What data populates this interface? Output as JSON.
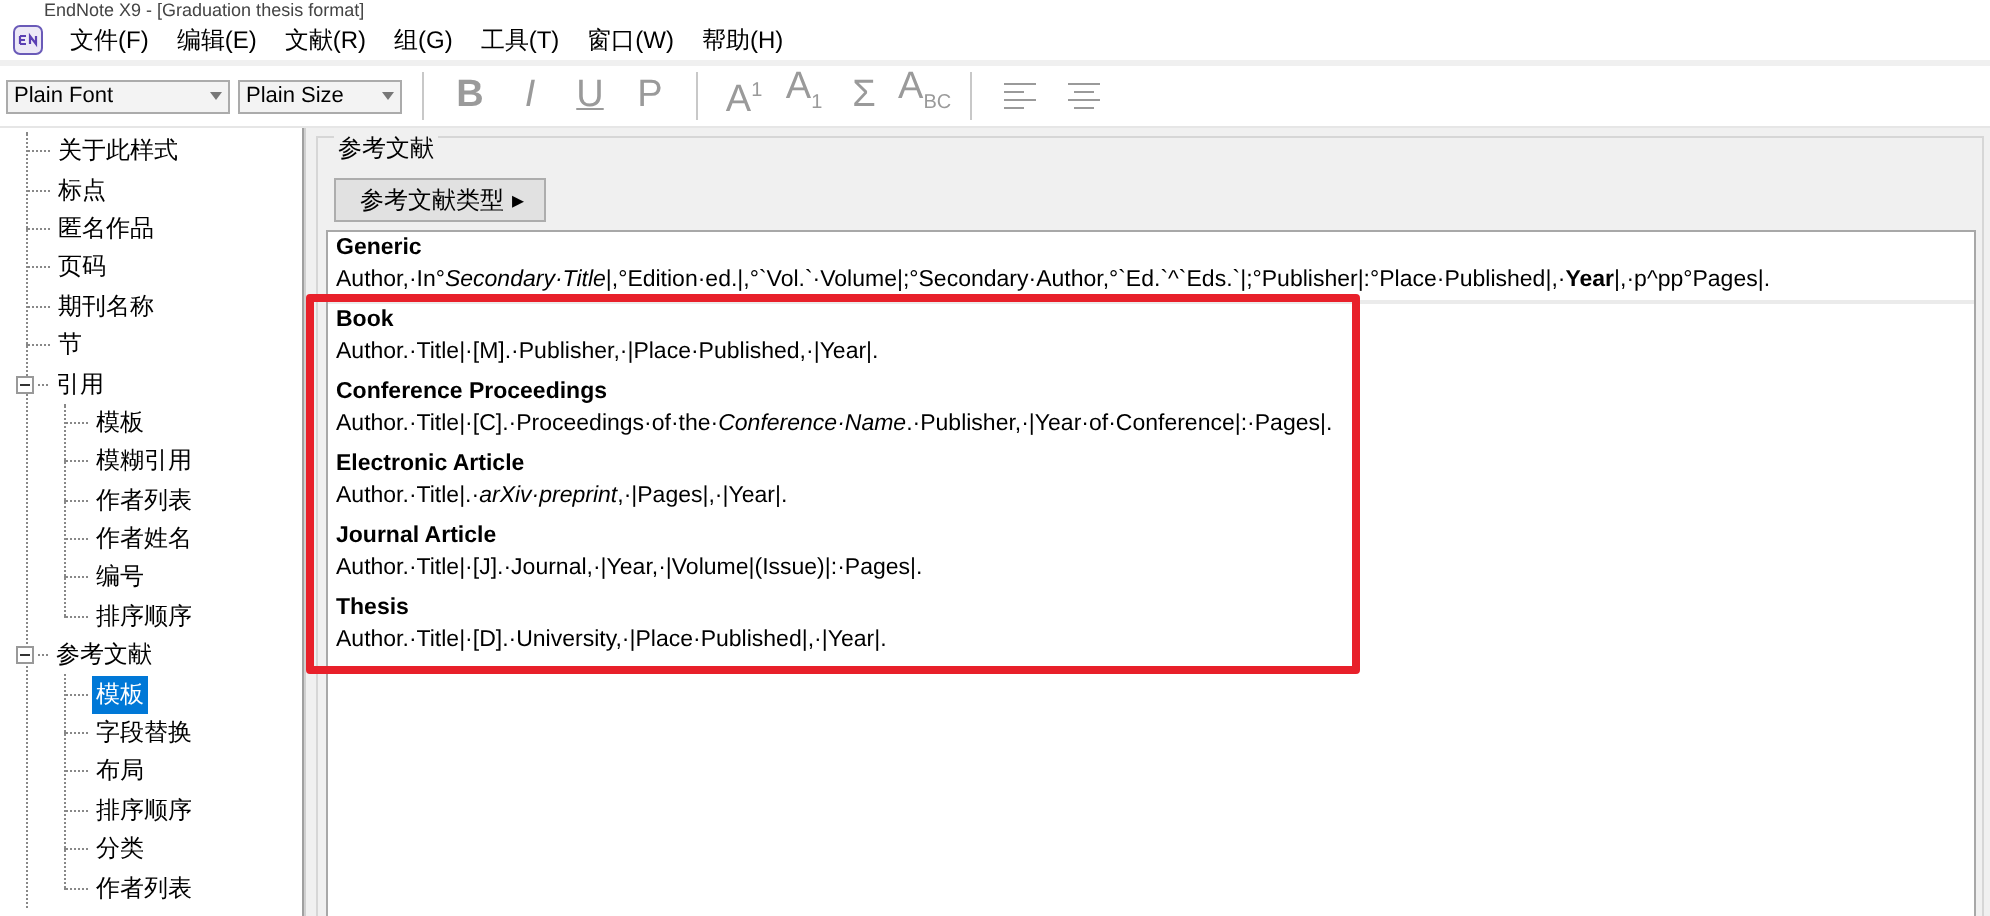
{
  "window": {
    "title": "EndNote X9 - [Graduation thesis format]"
  },
  "menu": [
    {
      "label": "文件(F)"
    },
    {
      "label": "编辑(E)"
    },
    {
      "label": "文献(R)"
    },
    {
      "label": "组(G)"
    },
    {
      "label": "工具(T)"
    },
    {
      "label": "窗口(W)"
    },
    {
      "label": "帮助(H)"
    }
  ],
  "toolbar": {
    "font": "Plain Font",
    "size": "Plain Size",
    "buttons": [
      {
        "kind": "bold",
        "label": "B"
      },
      {
        "kind": "italic",
        "label": "I"
      },
      {
        "kind": "underline",
        "label": "U"
      },
      {
        "kind": "plain",
        "label": "P"
      },
      {
        "kind": "sep"
      },
      {
        "kind": "plain",
        "label": "A$^{1}$"
      },
      {
        "kind": "plain",
        "label": "A$_{1}$"
      },
      {
        "kind": "plain",
        "label": "Σ"
      },
      {
        "kind": "plain",
        "label": "A$_{BC}$"
      },
      {
        "kind": "sep"
      },
      {
        "kind": "align-left"
      },
      {
        "kind": "align-center"
      }
    ]
  },
  "tree": [
    {
      "label": "关于此样式",
      "selected": false
    },
    {
      "label": "标点",
      "selected": false
    },
    {
      "label": "匿名作品",
      "selected": false
    },
    {
      "label": "页码",
      "selected": false
    },
    {
      "label": "期刊名称",
      "selected": false
    },
    {
      "label": "节",
      "selected": false
    },
    {
      "label": "引用",
      "selected": false,
      "expanded": true,
      "children": [
        {
          "label": "模板",
          "selected": false
        },
        {
          "label": "模糊引用",
          "selected": false
        },
        {
          "label": "作者列表",
          "selected": false
        },
        {
          "label": "作者姓名",
          "selected": false
        },
        {
          "label": "编号",
          "selected": false
        },
        {
          "label": "排序顺序",
          "selected": false
        }
      ]
    },
    {
      "label": "参考文献",
      "selected": false,
      "expanded": true,
      "children": [
        {
          "label": "模板",
          "selected": true
        },
        {
          "label": "字段替换",
          "selected": false
        },
        {
          "label": "布局",
          "selected": false
        },
        {
          "label": "排序顺序",
          "selected": false
        },
        {
          "label": "分类",
          "selected": false
        },
        {
          "label": "作者列表",
          "selected": false
        }
      ]
    }
  ],
  "panel": {
    "title": "参考文献",
    "type_button": "参考文献类型",
    "type_button_arrow": "▸",
    "templates": [
      {
        "name": "Generic",
        "template": "Author,·In°*Secondary·Title*|,°Edition·ed.|,°`Vol.`·Volume|;°Secondary·Author,°`Ed.`^`Eds.`|;°Publisher|:°Place·Published|,·**Year**|,·p^pp°Pages|."
      },
      {
        "name": "Book",
        "template": "Author.·Title|·[M].·Publisher,·|Place·Published,·|Year|."
      },
      {
        "name": "Conference Proceedings",
        "template": "Author.·Title|·[C].·Proceedings·of·the·*Conference·Name*.·Publisher,·|Year·of·Conference|:·Pages|."
      },
      {
        "name": "Electronic Article",
        "template": "Author.·Title|.·*arXiv·preprint*,·|Pages|,·|Year|."
      },
      {
        "name": "Journal Article",
        "template": "Author.·Title|·[J].·Journal,·|Year,·|Volume|(Issue)|:·Pages|."
      },
      {
        "name": "Thesis",
        "template": "Author.·Title|·[D].·University,·|Place·Published|,·|Year|."
      }
    ]
  }
}
